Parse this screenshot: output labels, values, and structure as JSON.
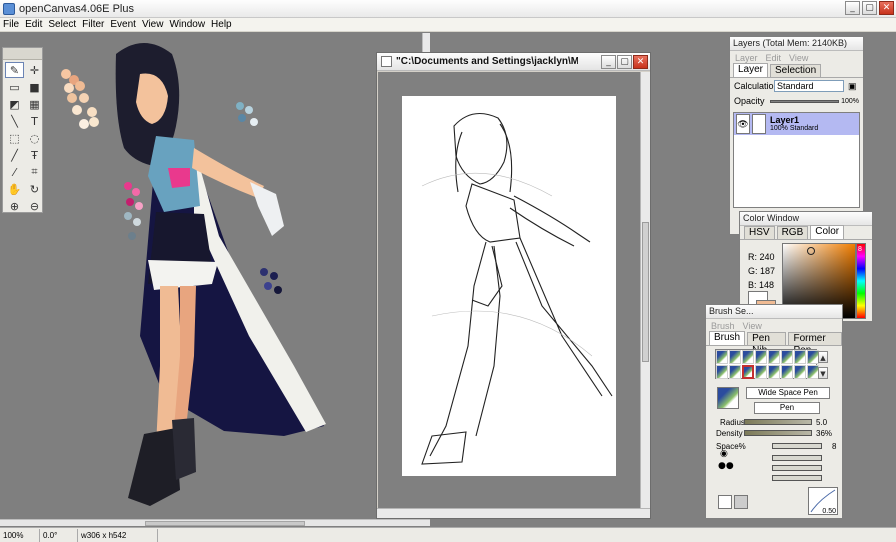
{
  "app": {
    "title": "openCanvas4.06E Plus"
  },
  "menu": [
    "File",
    "Edit",
    "Select",
    "Filter",
    "Event",
    "View",
    "Window",
    "Help"
  ],
  "document": {
    "title": "\"C:\\Documents and Settings\\jacklyn\\My Doc..."
  },
  "layers_panel": {
    "title": "Layers (Total Mem: 2140KB)",
    "menu": [
      "Layer",
      "Edit",
      "View"
    ],
    "tabs": [
      "Layer",
      "Selection"
    ],
    "calculation_label": "Calculation",
    "calculation_value": "Standard",
    "opacity_label": "Opacity",
    "opacity_value": "100%",
    "layer": {
      "name": "Layer1",
      "props": "100%  Standard"
    }
  },
  "color_window": {
    "title": "Color Window",
    "tabs": [
      "HSV",
      "RGB",
      "Color"
    ],
    "r": "R: 240",
    "g": "G: 187",
    "b": "B: 148",
    "hue_marker": "8",
    "color": "#f0bb94"
  },
  "brush_window": {
    "title": "Brush Se...",
    "menu": [
      "Brush",
      "View"
    ],
    "tabs": [
      "Brush",
      "Pen Nib",
      "Former Pen"
    ],
    "preset_name": "Wide Space Pen",
    "pen_type": "Pen",
    "radius_label": "Radius",
    "radius_value": "5.0",
    "density_label": "Density",
    "density_value": "36%",
    "space_label": "Space%",
    "space_value": "8",
    "curve_value": "0.50"
  },
  "status": {
    "zoom": "100%",
    "angle": "0.0°",
    "size": "w306 x h542"
  }
}
